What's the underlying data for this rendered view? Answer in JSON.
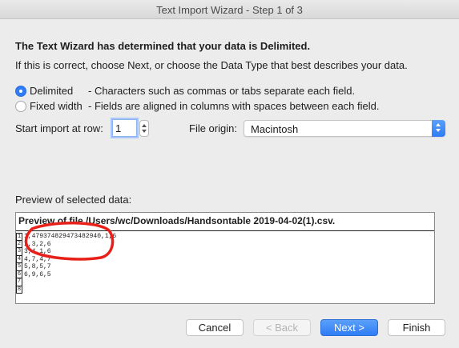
{
  "window": {
    "title": "Text Import Wizard - Step 1 of 3"
  },
  "intro": {
    "heading": "The Text Wizard has determined that your data is Delimited.",
    "subtext": "If this is correct, choose Next, or choose the Data Type that best describes your data."
  },
  "data_type": {
    "options": [
      {
        "label": "Delimited",
        "description": "- Characters such as commas or tabs separate each field.",
        "selected": true
      },
      {
        "label": "Fixed width",
        "description": "- Fields are aligned in columns with spaces between each field.",
        "selected": false
      }
    ]
  },
  "start_row": {
    "label": "Start import at row:",
    "value": "1"
  },
  "file_origin": {
    "label": "File origin:",
    "value": "Macintosh"
  },
  "preview": {
    "label": "Preview of selected data:",
    "header": "Preview of file /Users/wc/Downloads/Handsontable 2019-04-02(1).csv.",
    "rows": [
      {
        "num": "1",
        "text": "1,479374829473482940,1,6"
      },
      {
        "num": "2",
        "text": "2,3,2,6"
      },
      {
        "num": "3",
        "text": "3,4,1,6"
      },
      {
        "num": "4",
        "text": "4,7,4,7"
      },
      {
        "num": "5",
        "text": "5,8,5,7"
      },
      {
        "num": "6",
        "text": "6,9,6,5"
      },
      {
        "num": "7",
        "text": ""
      },
      {
        "num": "8",
        "text": ""
      }
    ]
  },
  "buttons": {
    "cancel": "Cancel",
    "back": "< Back",
    "next": "Next >",
    "finish": "Finish"
  },
  "colors": {
    "accent": "#2f7cf6",
    "annotation": "#e8201a",
    "window_bg": "#ececec"
  }
}
